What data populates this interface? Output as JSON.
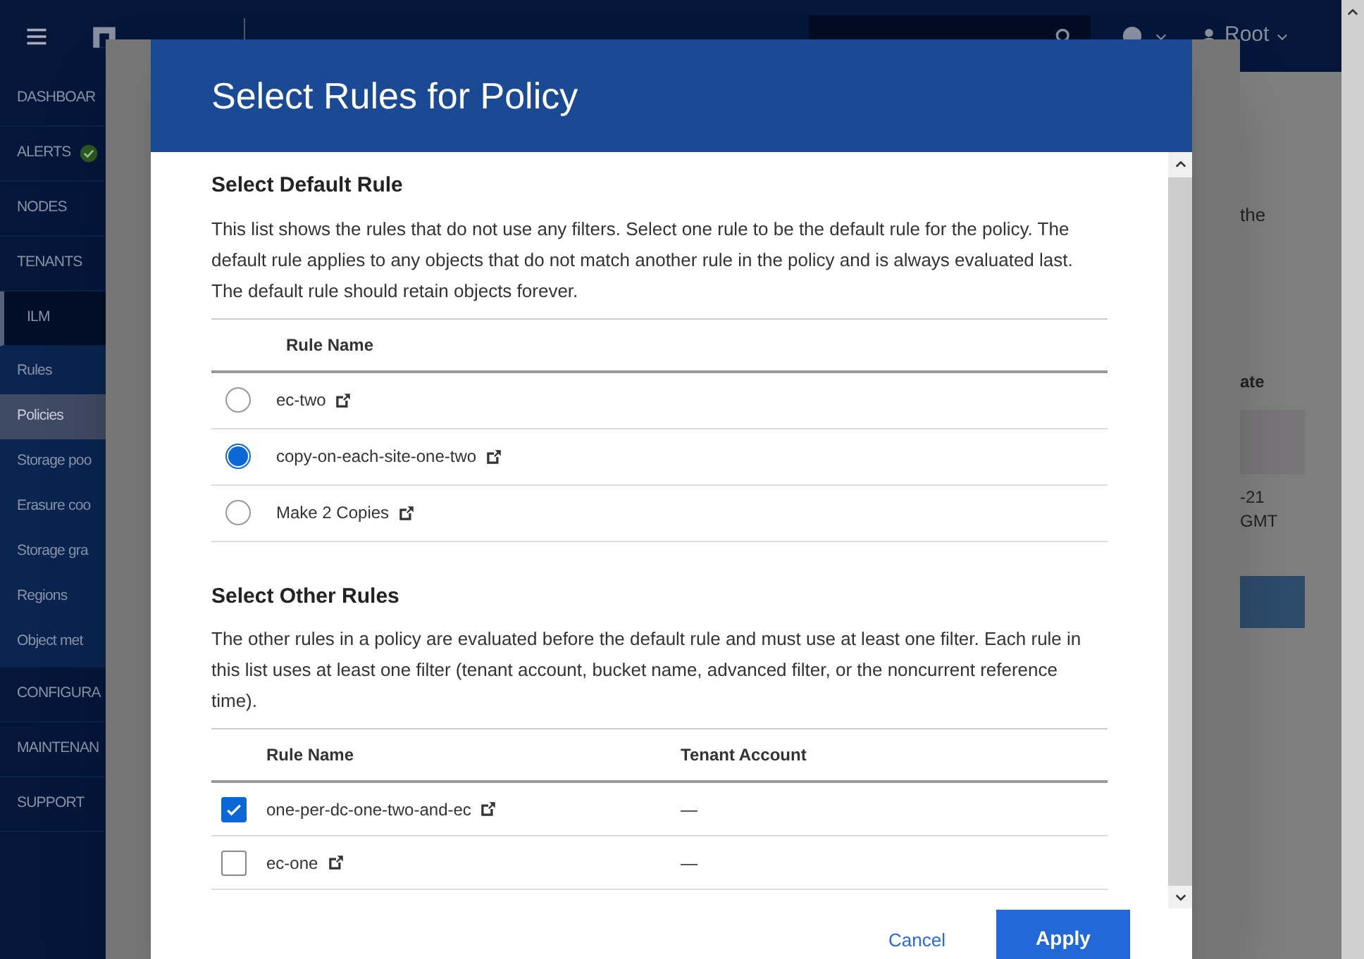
{
  "app_header": {
    "user": "Root"
  },
  "sidebar": {
    "items": [
      {
        "label": "DASHBOAR",
        "selected": false
      },
      {
        "label": "ALERTS",
        "selected": false
      },
      {
        "label": "NODES",
        "selected": false
      },
      {
        "label": "TENANTS",
        "selected": false
      },
      {
        "label": "ILM",
        "selected": false,
        "expanded": true,
        "children": [
          {
            "label": "Rules",
            "selected": false
          },
          {
            "label": "Policies",
            "selected": true
          },
          {
            "label": "Storage poo",
            "selected": false
          },
          {
            "label": "Erasure coo",
            "selected": false
          },
          {
            "label": "Storage gra",
            "selected": false
          },
          {
            "label": "Regions",
            "selected": false
          },
          {
            "label": "Object met",
            "selected": false
          }
        ]
      },
      {
        "label": "CONFIGURA",
        "selected": false
      },
      {
        "label": "MAINTENAN",
        "selected": false
      },
      {
        "label": "SUPPORT",
        "selected": false
      }
    ]
  },
  "page_fragments": {
    "text": "the",
    "column_heading": "ate",
    "cell_lines": [
      "-21",
      "GMT"
    ]
  },
  "dialog": {
    "title": "Select Rules for Policy",
    "default_rule": {
      "heading": "Select Default Rule",
      "description": "This list shows the rules that do not use any filters. Select one rule to be the default rule for the policy. The default rule applies to any objects that do not match another rule in the policy and is always evaluated last. The default rule should retain objects forever.",
      "columns": [
        "Rule Name"
      ],
      "rows": [
        {
          "name": "ec-two",
          "selected": false
        },
        {
          "name": "copy-on-each-site-one-two",
          "selected": true
        },
        {
          "name": "Make 2 Copies",
          "selected": false
        }
      ]
    },
    "other_rules": {
      "heading": "Select Other Rules",
      "description": "The other rules in a policy are evaluated before the default rule and must use at least one filter. Each rule in this list uses at least one filter (tenant account, bucket name, advanced filter, or the noncurrent reference time).",
      "columns": [
        "Rule Name",
        "Tenant Account"
      ],
      "rows": [
        {
          "name": "one-per-dc-one-two-and-ec",
          "tenant": "—",
          "checked": true
        },
        {
          "name": "ec-one",
          "tenant": "—",
          "checked": false
        }
      ]
    },
    "buttons": {
      "cancel": "Cancel",
      "apply": "Apply"
    }
  }
}
